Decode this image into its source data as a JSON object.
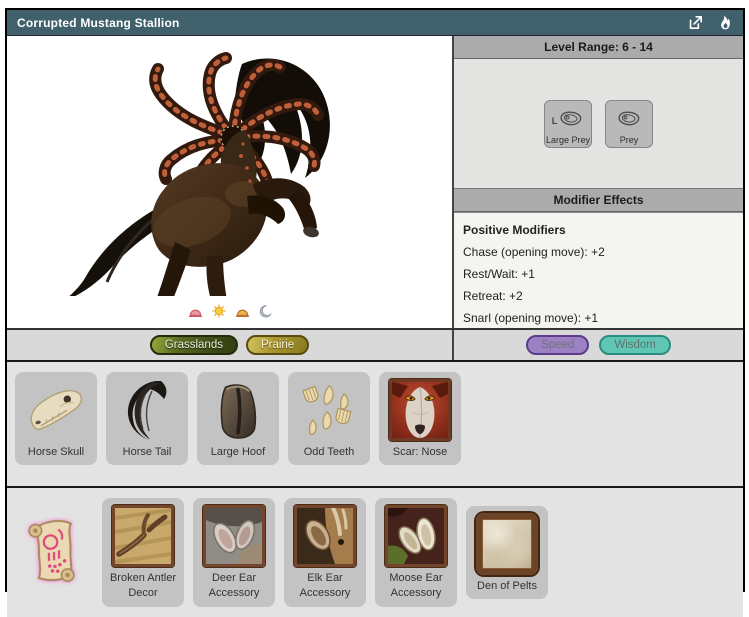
{
  "header": {
    "title": "Corrupted Mustang Stallion",
    "icons": [
      "external-link-icon",
      "flame-icon"
    ]
  },
  "level_panel": {
    "header": "Level Range: 6 - 14",
    "prey_buttons": [
      {
        "label": "Large Prey",
        "icon": "large-steak-icon",
        "size_prefix": "L"
      },
      {
        "label": "Prey",
        "icon": "steak-icon"
      }
    ]
  },
  "modifier_panel": {
    "header": "Modifier Effects",
    "section_title": "Positive Modifiers",
    "modifiers": [
      "Chase (opening move): +2",
      "Rest/Wait: +1",
      "Retreat: +2",
      "Snarl (opening move): +1"
    ]
  },
  "active_times": [
    {
      "name": "dawn",
      "icon": "dawn-icon"
    },
    {
      "name": "day",
      "icon": "sun-icon"
    },
    {
      "name": "dusk",
      "icon": "dusk-icon"
    },
    {
      "name": "night",
      "icon": "moon-icon"
    }
  ],
  "biomes": [
    {
      "label": "Grasslands"
    },
    {
      "label": "Prairie"
    }
  ],
  "stats": [
    {
      "label": "Speed",
      "color": "#9c82c4"
    },
    {
      "label": "Wisdom",
      "color": "#5fc6b3"
    }
  ],
  "drops": [
    {
      "label": "Horse Skull"
    },
    {
      "label": "Horse Tail"
    },
    {
      "label": "Large Hoof"
    },
    {
      "label": "Odd Teeth"
    },
    {
      "label": "Scar: Nose"
    }
  ],
  "craftables": [
    {
      "label": "Broken Antler Decor"
    },
    {
      "label": "Deer Ear Accessory"
    },
    {
      "label": "Elk Ear Accessory"
    },
    {
      "label": "Moose Ear Accessory"
    },
    {
      "label": "Den of Pelts"
    }
  ],
  "colors": {
    "header_bg": "#40606c",
    "speed_accent": "#9c82c4",
    "wisdom_accent": "#5fc6b3",
    "grasslands": "#3c4c16",
    "prairie": "#a7942e"
  }
}
